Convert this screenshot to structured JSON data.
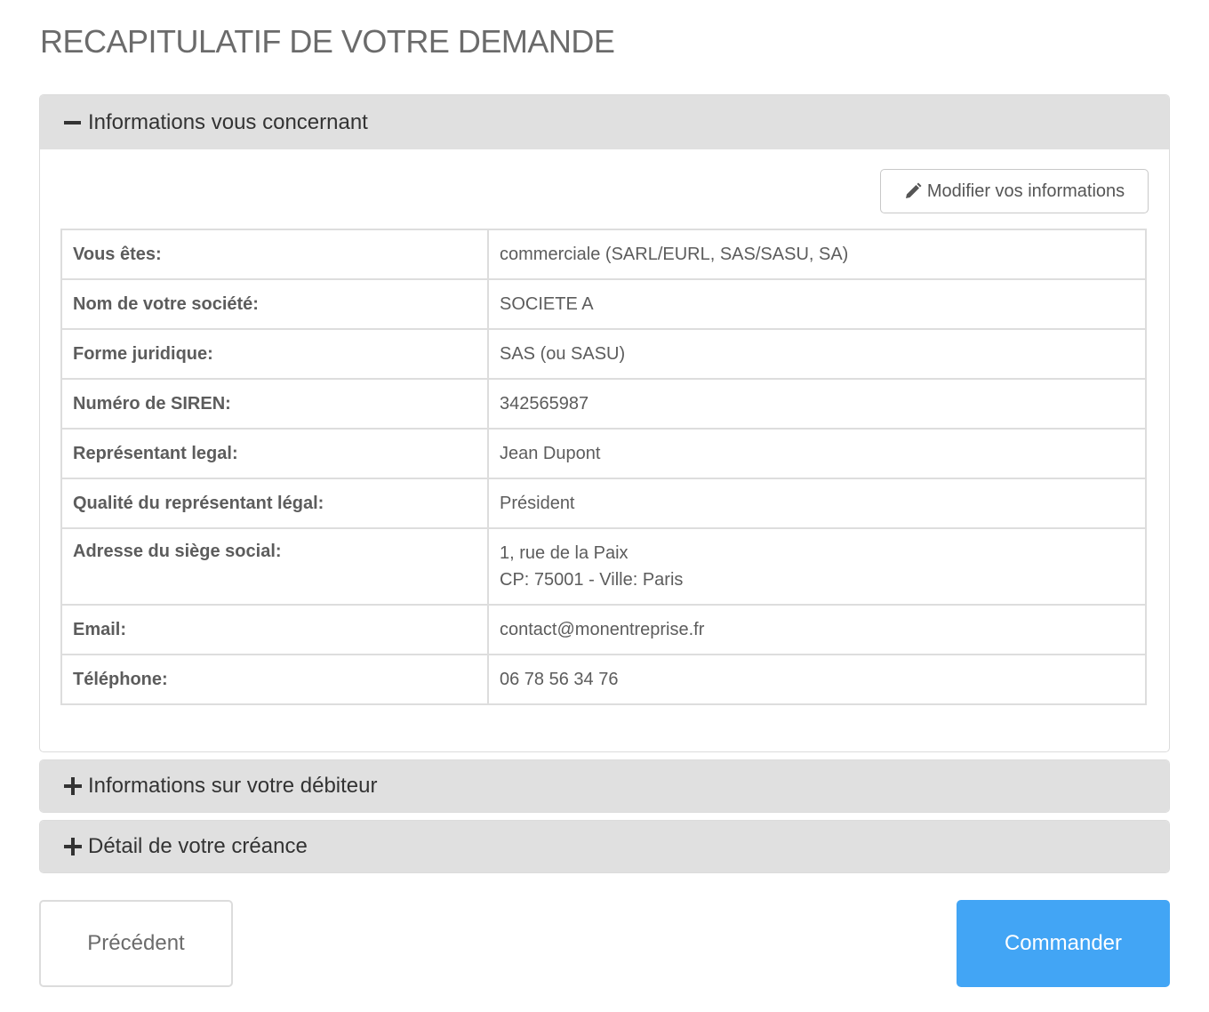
{
  "page": {
    "title": "RECAPITULATIF DE VOTRE DEMANDE"
  },
  "sections": [
    {
      "title": "Informations vous concernant",
      "expanded": true,
      "edit_button_label": "Modifier vos informations",
      "rows": [
        {
          "label": "Vous êtes:",
          "value": "commerciale (SARL/EURL, SAS/SASU, SA)"
        },
        {
          "label": "Nom de votre société:",
          "value": "SOCIETE A"
        },
        {
          "label": "Forme juridique:",
          "value": "SAS (ou SASU)"
        },
        {
          "label": "Numéro de SIREN:",
          "value": "342565987"
        },
        {
          "label": "Représentant legal:",
          "value": "Jean Dupont"
        },
        {
          "label": "Qualité du représentant légal:",
          "value": "Président"
        },
        {
          "label": "Adresse du siège social:",
          "value": "1, rue de la Paix",
          "value_line2": "CP: 75001 - Ville: Paris"
        },
        {
          "label": "Email:",
          "value": "contact@monentreprise.fr"
        },
        {
          "label": "Téléphone:",
          "value": "06 78 56 34 76"
        }
      ]
    },
    {
      "title": "Informations sur votre débiteur",
      "expanded": false
    },
    {
      "title": "Détail de votre créance",
      "expanded": false
    }
  ],
  "actions": {
    "previous_label": "Précédent",
    "order_label": "Commander"
  },
  "colors": {
    "accent": "#42a5f5",
    "panel_header": "#e0e0e0",
    "border": "#dddddd"
  },
  "icons": {
    "expanded": "minus-icon",
    "collapsed": "plus-icon",
    "edit": "pencil-icon"
  }
}
